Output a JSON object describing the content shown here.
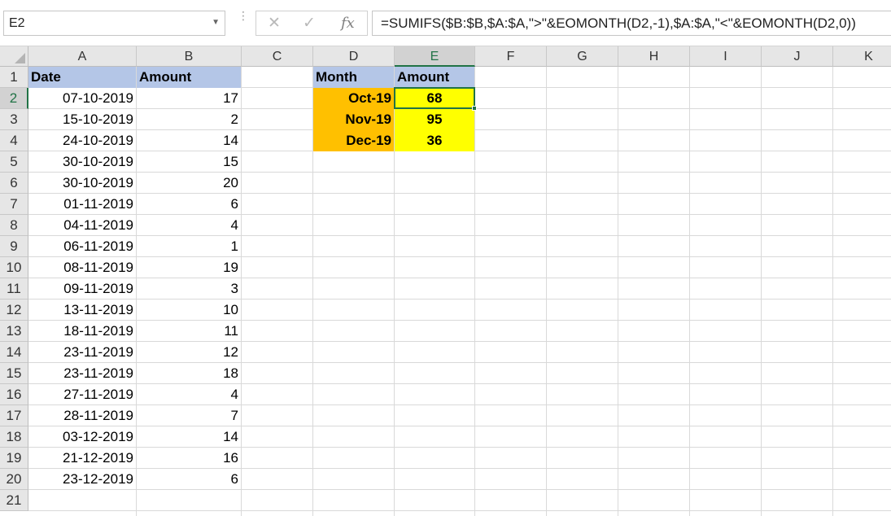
{
  "formula_bar": {
    "name_box": "E2",
    "cancel_icon": "close-icon",
    "enter_icon": "check-icon",
    "function_icon": "fx-icon",
    "fx_label": "fx",
    "formula": "=SUMIFS($B:$B,$A:$A,\">\"&EOMONTH(D2,-1),$A:$A,\"<\"&EOMONTH(D2,0))"
  },
  "sheet": {
    "columns": [
      "A",
      "B",
      "C",
      "D",
      "E",
      "F",
      "G",
      "H",
      "I",
      "J",
      "K"
    ],
    "rows": [
      "1",
      "2",
      "3",
      "4",
      "5",
      "6",
      "7",
      "8",
      "9",
      "10",
      "11",
      "12",
      "13",
      "14",
      "15",
      "16",
      "17",
      "18",
      "19",
      "20",
      "21"
    ],
    "selected_column": "E",
    "selected_row": "2",
    "source_table": {
      "headers": [
        "Date",
        "Amount"
      ],
      "rows": [
        [
          "07-10-2019",
          "17"
        ],
        [
          "15-10-2019",
          "2"
        ],
        [
          "24-10-2019",
          "14"
        ],
        [
          "30-10-2019",
          "15"
        ],
        [
          "30-10-2019",
          "20"
        ],
        [
          "01-11-2019",
          "6"
        ],
        [
          "04-11-2019",
          "4"
        ],
        [
          "06-11-2019",
          "1"
        ],
        [
          "08-11-2019",
          "19"
        ],
        [
          "09-11-2019",
          "3"
        ],
        [
          "13-11-2019",
          "10"
        ],
        [
          "18-11-2019",
          "11"
        ],
        [
          "23-11-2019",
          "12"
        ],
        [
          "23-11-2019",
          "18"
        ],
        [
          "27-11-2019",
          "4"
        ],
        [
          "28-11-2019",
          "7"
        ],
        [
          "03-12-2019",
          "14"
        ],
        [
          "21-12-2019",
          "16"
        ],
        [
          "23-12-2019",
          "6"
        ]
      ]
    },
    "summary_table": {
      "headers": [
        "Month",
        "Amount"
      ],
      "rows": [
        [
          "Oct-19",
          "68"
        ],
        [
          "Nov-19",
          "95"
        ],
        [
          "Dec-19",
          "36"
        ]
      ]
    },
    "colors": {
      "header_fill": "#b4c6e7",
      "month_fill": "#ffc000",
      "result_fill": "#ffff00",
      "selection": "#217346"
    }
  }
}
